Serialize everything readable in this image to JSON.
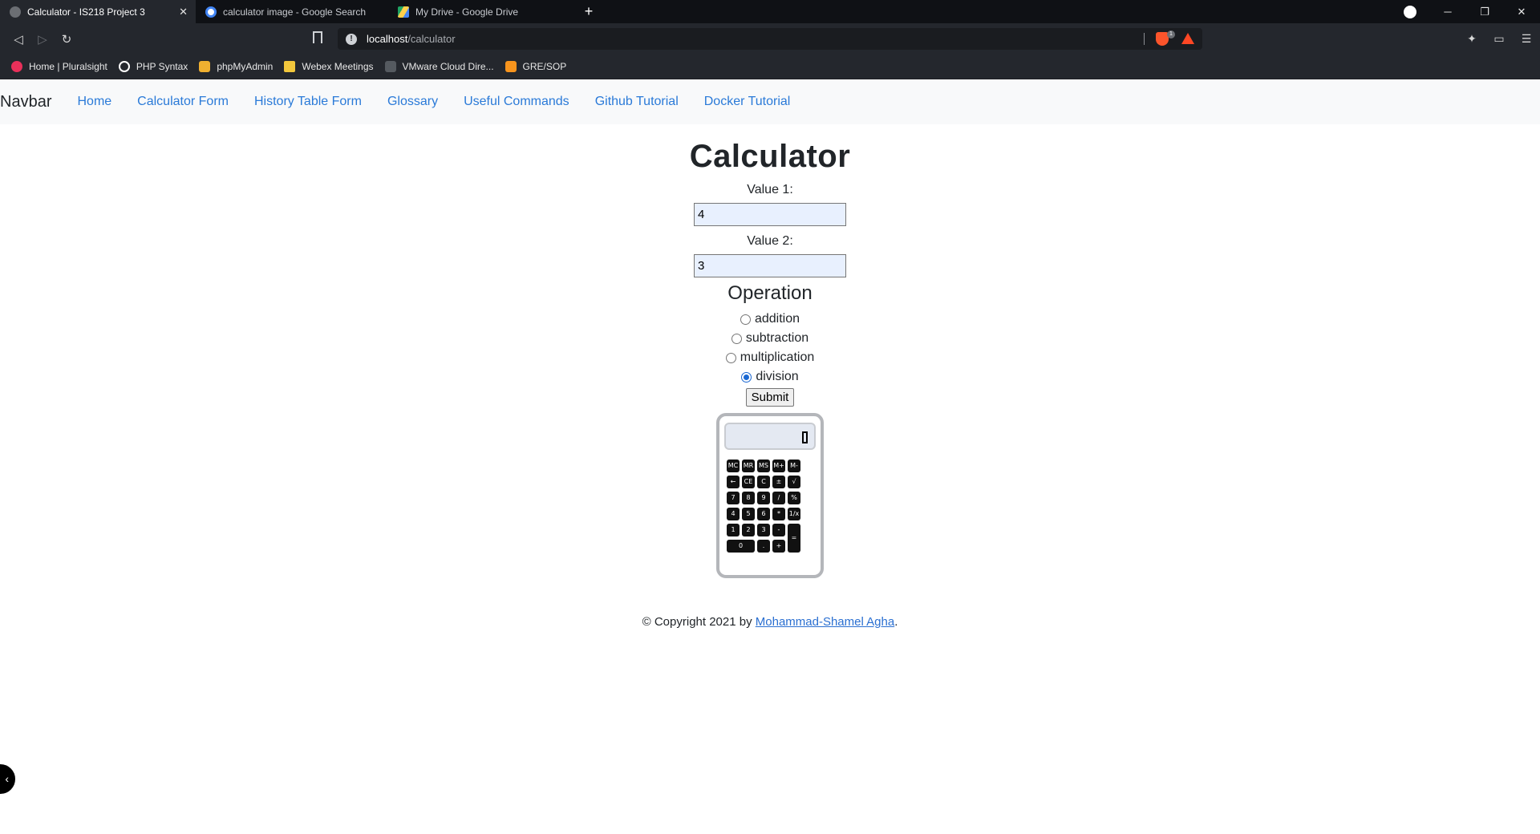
{
  "browser": {
    "tabs": [
      {
        "title": "Calculator - IS218 Project 3",
        "active": true
      },
      {
        "title": "calculator image - Google Search",
        "active": false
      },
      {
        "title": "My Drive - Google Drive",
        "active": false
      }
    ],
    "url_host": "localhost",
    "url_path": "/calculator",
    "bookmarks": [
      "Home | Pluralsight",
      "PHP Syntax",
      "phpMyAdmin",
      "Webex Meetings",
      "VMware Cloud Dire...",
      "GRE/SOP"
    ],
    "brave_badge": "1"
  },
  "navbar": {
    "brand": "Navbar",
    "links": [
      "Home",
      "Calculator Form",
      "History Table Form",
      "Glossary",
      "Useful Commands",
      "Github Tutorial",
      "Docker Tutorial"
    ]
  },
  "page": {
    "title": "Calculator",
    "value1_label": "Value 1:",
    "value1": "4",
    "value2_label": "Value 2:",
    "value2": "3",
    "operation_title": "Operation",
    "operations": [
      "addition",
      "subtraction",
      "multiplication",
      "division"
    ],
    "selected_operation": "division",
    "submit_label": "Submit"
  },
  "calculator_image": {
    "keys": [
      [
        "MC",
        "MR",
        "MS",
        "M+",
        "M-"
      ],
      [
        "←",
        "CE",
        "C",
        "±",
        "√"
      ],
      [
        "7",
        "8",
        "9",
        "/",
        "%"
      ],
      [
        "4",
        "5",
        "6",
        "*",
        "1/x"
      ],
      [
        "1",
        "2",
        "3",
        "-",
        "="
      ],
      [
        "0",
        ".",
        "+"
      ]
    ]
  },
  "footer": {
    "prefix": "© Copyright 2021 by ",
    "author": "Mohammad-Shamel Agha",
    "suffix": "."
  },
  "colors": {
    "link": "#2a7ad8",
    "chrome_dark": "#24272d",
    "tabbar": "#0f1115",
    "navbar_bg": "#f8f9fa"
  }
}
